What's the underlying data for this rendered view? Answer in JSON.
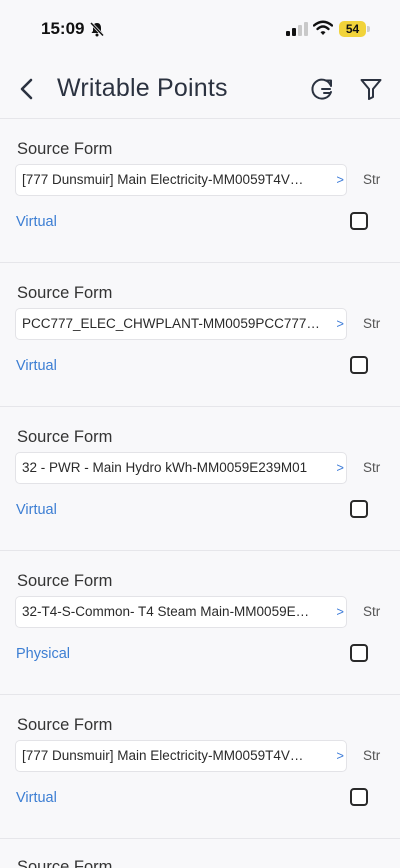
{
  "status_bar": {
    "time": "15:09",
    "battery": "54",
    "icons": [
      "bell-slash-icon",
      "cellular-signal-icon",
      "wifi-icon",
      "battery-icon"
    ],
    "battery_color": "#f1d33a"
  },
  "header": {
    "title": "Writable Points",
    "back_icon": "chevron-left-icon",
    "refresh_icon": "refresh-icon",
    "filter_icon": "filter-icon"
  },
  "colors": {
    "accent": "#3c7ed3",
    "background": "#f8f8fa"
  },
  "items": [
    {
      "label": "Source Form",
      "source": "[777 Dunsmuir] Main Electricity-MM0059T4V…",
      "trailing": "Str",
      "type": "Virtual",
      "checked": false
    },
    {
      "label": "Source Form",
      "source": "PCC777_ELEC_CHWPLANT-MM0059PCC777…",
      "trailing": "Str",
      "type": "Virtual",
      "checked": false
    },
    {
      "label": "Source Form",
      "source": "32 - PWR -  Main Hydro kWh-MM0059E239M01",
      "trailing": "Str",
      "type": "Virtual",
      "checked": false
    },
    {
      "label": "Source Form",
      "source": "32-T4-S-Common- T4 Steam Main-MM0059E…",
      "trailing": "Str",
      "type": "Physical",
      "checked": false
    },
    {
      "label": "Source Form",
      "source": "[777 Dunsmuir] Main Electricity-MM0059T4V…",
      "trailing": "Str",
      "type": "Virtual",
      "checked": false
    }
  ],
  "partial_item": {
    "label": "Source Form"
  }
}
